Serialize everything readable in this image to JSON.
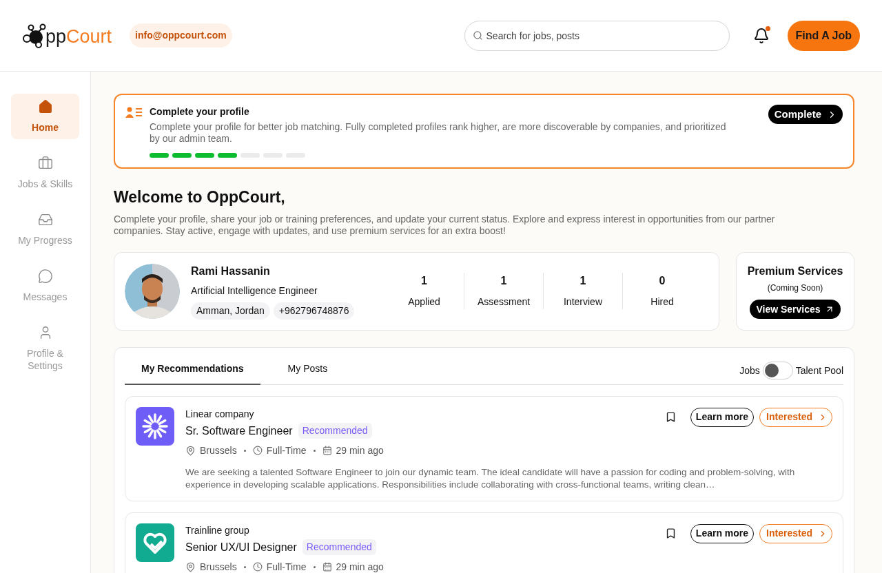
{
  "header": {
    "logo_prefix": "pp",
    "logo_suffix": "Court",
    "email": "info@oppcourt.com",
    "search": {
      "placeholder": "Search for jobs, posts"
    },
    "notification_unread": true,
    "cta": "Find A Job"
  },
  "sidebar": {
    "items": [
      {
        "label": "Home",
        "selected": true
      },
      {
        "label": "Jobs & Skills",
        "selected": false
      },
      {
        "label": "My Progress",
        "selected": false
      },
      {
        "label": "Messages",
        "selected": false
      },
      {
        "label": "Profile & Settings",
        "selected": false
      }
    ]
  },
  "profile_banner": {
    "title": "Complete your profile",
    "text": "Complete your profile for better job matching. Fully completed profiles rank higher, are more discoverable by companies, and prioritized by our admin team.",
    "button": "Complete",
    "segments": [
      {
        "done": true
      },
      {
        "done": true
      },
      {
        "done": true
      },
      {
        "done": true
      },
      {
        "done": false
      },
      {
        "done": false
      },
      {
        "done": false
      }
    ]
  },
  "welcome": {
    "title": "Welcome to OppCourt,",
    "text": "Complete your profile, share your job or training preferences, and update your current status. Explore and express interest in opportunities from our partner companies. Stay active, engage with updates, and use premium services for an extra boost!"
  },
  "user": {
    "name": "Rami Hassanin",
    "role": "Artificial Intelligence Engineer",
    "location": "Amman, Jordan",
    "phone": "+962796748876",
    "stats": [
      {
        "value": "1",
        "label": "Applied"
      },
      {
        "value": "1",
        "label": "Assessment"
      },
      {
        "value": "1",
        "label": "Interview"
      },
      {
        "value": "0",
        "label": "Hired"
      }
    ]
  },
  "premium": {
    "title": "Premium Services",
    "subtitle": "(Coming Soon)",
    "button": "View Services"
  },
  "feed": {
    "tabs": [
      {
        "label": "My Recommendations",
        "selected": true
      },
      {
        "label": "My Posts",
        "selected": false
      }
    ],
    "toggle": {
      "left": "Jobs",
      "right": "Talent Pool",
      "on": false
    },
    "jobs": [
      {
        "company": "Linear company",
        "color": "#6e5df6",
        "title": "Sr. Software Engineer",
        "badge": "Recommended",
        "location": "Brussels",
        "type": "Full-Time",
        "posted": "29 min ago",
        "description": "We are seeking a talented Software Engineer to join our dynamic team. The ideal candidate will have a passion for coding and problem-solving, with experience in developing scalable applications. Responsibilities include collaborating with cross-functional teams, writing clean…",
        "learn": "Learn more",
        "interest": "Interested"
      },
      {
        "company": "Trainline group",
        "color": "#10ab91",
        "title": "Senior UX/UI Designer",
        "badge": "Recommended",
        "location": "Brussels",
        "type": "Full-Time",
        "posted": "29 min ago",
        "learn": "Learn more",
        "interest": "Interested"
      }
    ]
  }
}
